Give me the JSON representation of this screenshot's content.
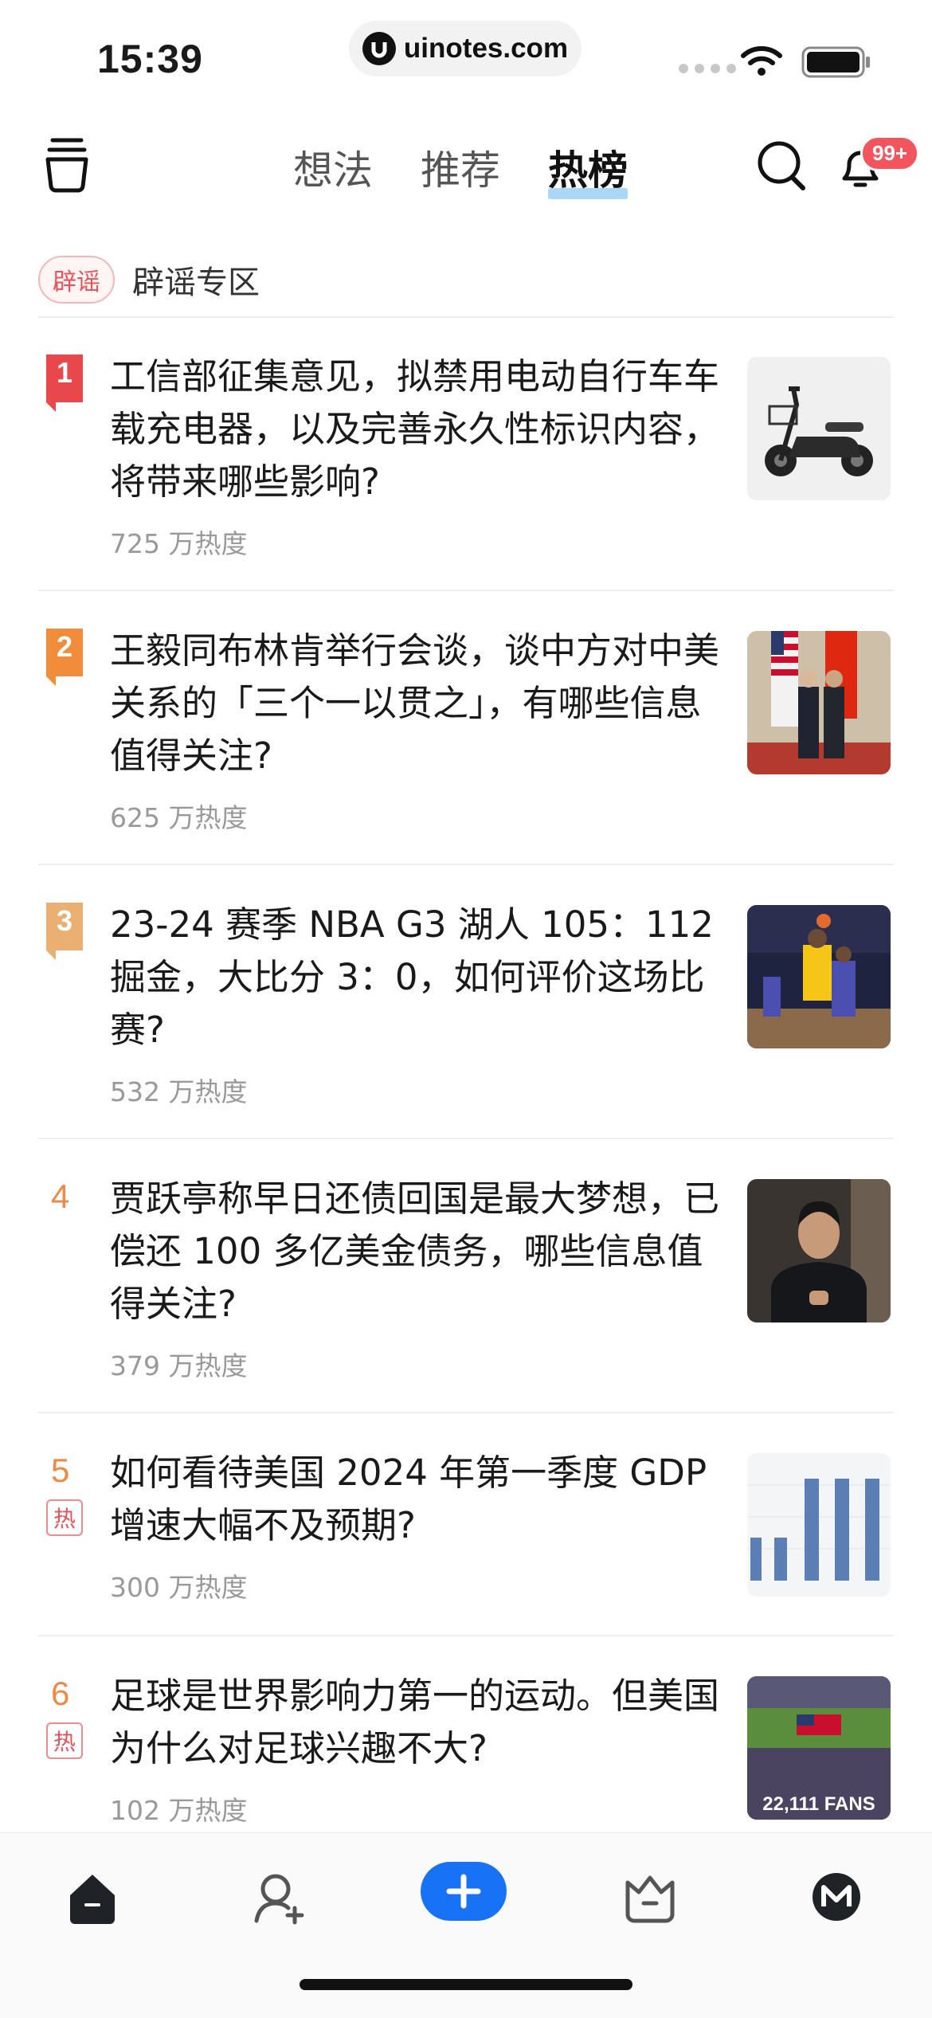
{
  "status": {
    "time": "15:39",
    "url": "uinotes.com"
  },
  "nav": {
    "tabs": [
      {
        "label": "想法",
        "active": false
      },
      {
        "label": "推荐",
        "active": false
      },
      {
        "label": "热榜",
        "active": true
      }
    ],
    "notification_badge": "99+"
  },
  "rumor": {
    "badge": "辟谣",
    "label": "辟谣专区"
  },
  "hot_list": [
    {
      "rank": "1",
      "title": "工信部征集意见，拟禁用电动自行车车载充电器，以及完善永久性标识内容，将带来哪些影响?",
      "heat": "725 万热度",
      "thumb_icon": "e-bike-image"
    },
    {
      "rank": "2",
      "title": "王毅同布林肯举行会谈，谈中方对中美关系的「三个一以贯之」，有哪些信息值得关注?",
      "heat": "625 万热度",
      "thumb_icon": "diplomats-handshake-image"
    },
    {
      "rank": "3",
      "title": "23-24 赛季 NBA G3 湖人 105：112 掘金，大比分 3：0，如何评价这场比赛?",
      "heat": "532 万热度",
      "thumb_icon": "basketball-game-image"
    },
    {
      "rank": "4",
      "title": "贾跃亭称早日还债回国是最大梦想，已偿还 100 多亿美金债务，哪些信息值得关注?",
      "heat": "379 万热度",
      "thumb_icon": "man-portrait-image"
    },
    {
      "rank": "5",
      "hot_tag": "热",
      "title": "如何看待美国 2024 年第一季度 GDP 增速大幅不及预期?",
      "heat": "300 万热度",
      "thumb_icon": "gdp-bar-chart-image"
    },
    {
      "rank": "6",
      "hot_tag": "热",
      "title": "足球是世界影响力第一的运动。但美国为什么对足球兴趣不大?",
      "heat": "102 万热度",
      "thumb_icon": "stadium-image",
      "thumb_caption": "22,111 FANS"
    }
  ],
  "colors": {
    "rank1": "#e8474c",
    "rank2": "#f08c3a",
    "rank3": "#e9b072",
    "rank_plain": "#ee8a45",
    "accent_blue": "#1772f6"
  }
}
